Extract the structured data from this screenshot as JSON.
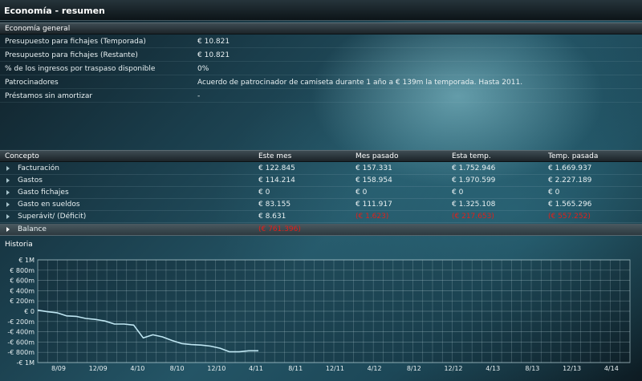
{
  "window": {
    "title": "Economía - resumen"
  },
  "general": {
    "header": "Economía general",
    "rows": [
      {
        "label": "Presupuesto para fichajes (Temporada)",
        "value": "€ 10.821"
      },
      {
        "label": "Presupuesto para fichajes (Restante)",
        "value": "€ 10.821"
      },
      {
        "label": "% de los ingresos por traspaso disponible",
        "value": "0%"
      },
      {
        "label": "Patrocinadores",
        "value": "Acuerdo de patrocinador de camiseta durante 1 año a € 139m la temporada. Hasta 2011."
      },
      {
        "label": "Préstamos sin amortizar",
        "value": "-"
      }
    ]
  },
  "finance": {
    "columns": [
      "Concepto",
      "Este mes",
      "Mes pasado",
      "Esta temp.",
      "Temp. pasada"
    ],
    "rows": [
      {
        "label": "Facturación",
        "values": [
          "€ 122.845",
          "€ 157.331",
          "€ 1.752.946",
          "€ 1.669.937"
        ],
        "negative": [
          false,
          false,
          false,
          false
        ]
      },
      {
        "label": "Gastos",
        "values": [
          "€ 114.214",
          "€ 158.954",
          "€ 1.970.599",
          "€ 2.227.189"
        ],
        "negative": [
          false,
          false,
          false,
          false
        ]
      },
      {
        "label": "Gasto fichajes",
        "values": [
          "€ 0",
          "€ 0",
          "€ 0",
          "€ 0"
        ],
        "negative": [
          false,
          false,
          false,
          false
        ]
      },
      {
        "label": "Gasto en sueldos",
        "values": [
          "€ 83.155",
          "€ 111.917",
          "€ 1.325.108",
          "€ 1.565.296"
        ],
        "negative": [
          false,
          false,
          false,
          false
        ]
      },
      {
        "label": "Superávit/ (Déficit)",
        "values": [
          "€ 8.631",
          "(€ 1.623)",
          "(€ 217.653)",
          "(€ 557.252)"
        ],
        "negative": [
          false,
          true,
          true,
          true
        ]
      }
    ],
    "balance": {
      "label": "Balance",
      "value": "(€ 761.396)"
    }
  },
  "history": {
    "label": "Historia",
    "line_color": "#bfe6f2",
    "chart_data": {
      "type": "line",
      "title": "",
      "ylim": [
        -1000000,
        1000000
      ],
      "ytick_labels": [
        "€ 1M",
        "€ 800m",
        "€ 600m",
        "€ 400m",
        "€ 200m",
        "€ 0",
        "-€ 200m",
        "-€ 400m",
        "-€ 600m",
        "-€ 800m",
        "-€ 1M"
      ],
      "ytick_values": [
        1000000,
        800000,
        600000,
        400000,
        200000,
        0,
        -200000,
        -400000,
        -600000,
        -800000,
        -1000000
      ],
      "xtick_labels": [
        "8/09",
        "12/09",
        "4/10",
        "8/10",
        "12/10",
        "4/11",
        "8/11",
        "12/11",
        "4/12",
        "8/12",
        "12/12",
        "4/13",
        "8/13",
        "12/13",
        "4/14"
      ],
      "grid": true,
      "series": [
        {
          "values": [
            20000,
            -10000,
            -30000,
            -90000,
            -100000,
            -140000,
            -160000,
            -190000,
            -250000,
            -250000,
            -270000,
            -520000,
            -460000,
            -500000,
            -570000,
            -630000,
            -650000,
            -660000,
            -680000,
            -720000,
            -790000,
            -790000,
            -770000,
            -770000
          ]
        }
      ]
    }
  }
}
